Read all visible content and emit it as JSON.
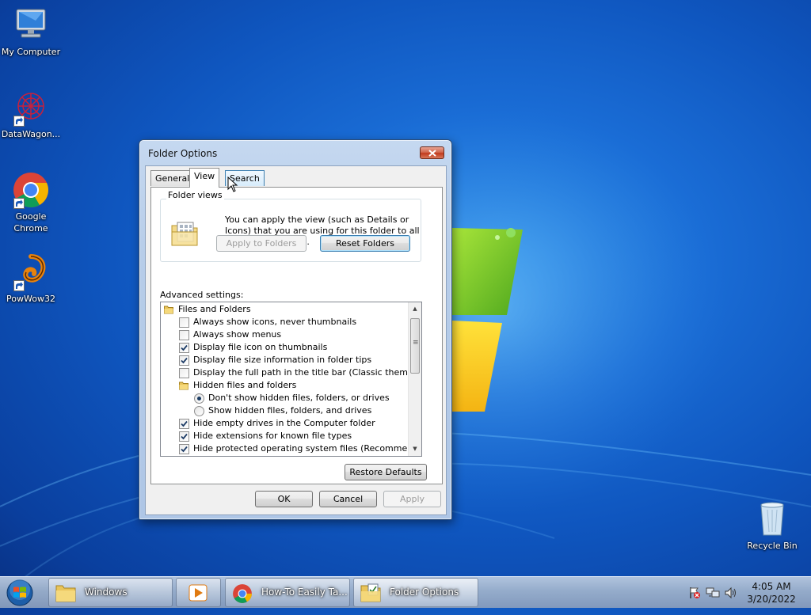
{
  "desktop": {
    "icons": [
      {
        "label": "My Computer",
        "icon": "computer-icon"
      },
      {
        "label": "DataWagon...",
        "icon": "datawagon-icon"
      },
      {
        "label": "Google Chrome",
        "icon": "chrome-icon"
      },
      {
        "label": "PowWow32",
        "icon": "powwow-icon"
      },
      {
        "label": "Recycle Bin",
        "icon": "recycle-bin-icon"
      }
    ]
  },
  "dialog": {
    "title": "Folder Options",
    "tabs": [
      {
        "label": "General",
        "active": false
      },
      {
        "label": "View",
        "active": true
      },
      {
        "label": "Search",
        "active": false
      }
    ],
    "folder_views": {
      "legend": "Folder views",
      "description": "You can apply the view (such as Details or Icons) that you are using for this folder to all folders of this type.",
      "apply_button": "Apply to Folders",
      "reset_button": "Reset Folders"
    },
    "advanced_label": "Advanced settings:",
    "tree": [
      {
        "type": "folder",
        "label": "Files and Folders",
        "level": 0
      },
      {
        "type": "checkbox",
        "label": "Always show icons, never thumbnails",
        "checked": false,
        "level": 1
      },
      {
        "type": "checkbox",
        "label": "Always show menus",
        "checked": false,
        "level": 1
      },
      {
        "type": "checkbox",
        "label": "Display file icon on thumbnails",
        "checked": true,
        "level": 1
      },
      {
        "type": "checkbox",
        "label": "Display file size information in folder tips",
        "checked": true,
        "level": 1
      },
      {
        "type": "checkbox",
        "label": "Display the full path in the title bar (Classic theme only)",
        "checked": false,
        "level": 1
      },
      {
        "type": "folder",
        "label": "Hidden files and folders",
        "level": 1
      },
      {
        "type": "radio",
        "label": "Don't show hidden files, folders, or drives",
        "checked": true,
        "level": 2
      },
      {
        "type": "radio",
        "label": "Show hidden files, folders, and drives",
        "checked": false,
        "level": 2
      },
      {
        "type": "checkbox",
        "label": "Hide empty drives in the Computer folder",
        "checked": true,
        "level": 1
      },
      {
        "type": "checkbox",
        "label": "Hide extensions for known file types",
        "checked": true,
        "level": 1
      },
      {
        "type": "checkbox",
        "label": "Hide protected operating system files (Recommended)",
        "checked": true,
        "level": 1
      }
    ],
    "restore_defaults": "Restore Defaults",
    "ok": "OK",
    "cancel": "Cancel",
    "apply": "Apply"
  },
  "taskbar": {
    "items": [
      {
        "label": "Windows",
        "icon": "folder-icon",
        "active": false
      },
      {
        "label": "",
        "icon": "media-player-icon",
        "active": false
      },
      {
        "label": "How-To Easily Ta...",
        "icon": "chrome-icon",
        "active": false
      },
      {
        "label": "Folder Options",
        "icon": "folder-options-icon",
        "active": true
      }
    ],
    "clock": {
      "time": "4:05 AM",
      "date": "3/20/2022"
    }
  }
}
